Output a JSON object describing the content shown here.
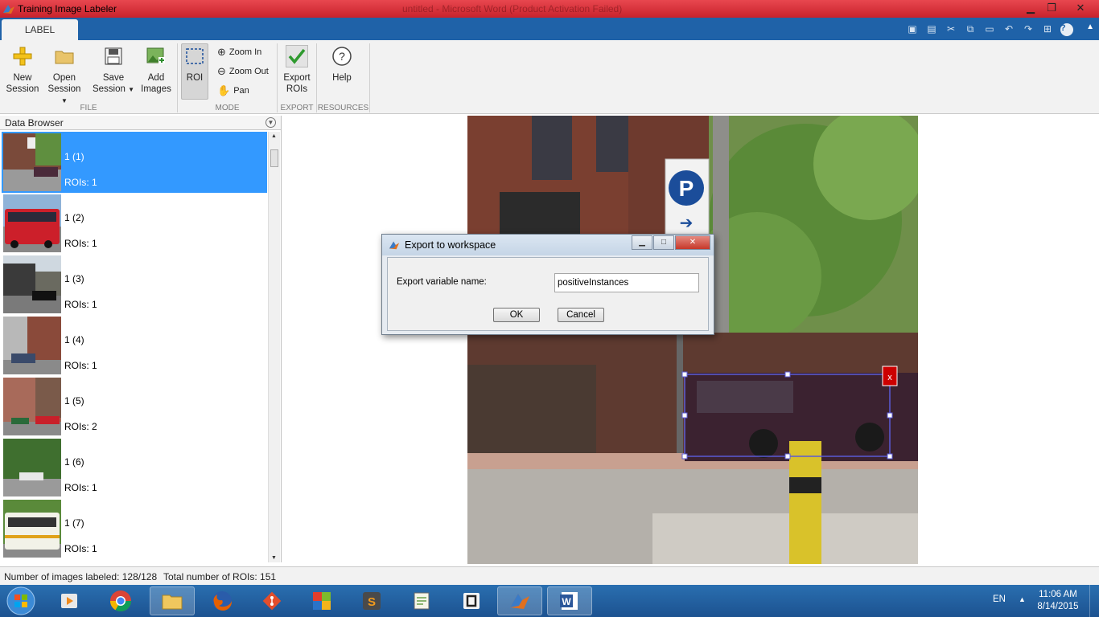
{
  "window": {
    "title": "Training Image Labeler",
    "background_title": "untitled - Microsoft Word (Product Activation Failed)"
  },
  "tabstrip": {
    "active_tab": "LABEL"
  },
  "ribbon": {
    "new_session": [
      "New",
      "Session"
    ],
    "open_session": [
      "Open",
      "Session"
    ],
    "save_session": [
      "Save",
      "Session"
    ],
    "add_images": [
      "Add",
      "Images"
    ],
    "roi": "ROI",
    "zoom_in": "Zoom In",
    "zoom_out": "Zoom Out",
    "pan": "Pan",
    "export_rois": [
      "Export",
      "ROIs"
    ],
    "help": "Help",
    "groups": {
      "file": "FILE",
      "mode": "MODE",
      "export": "EXPORT",
      "resources": "RESOURCES"
    }
  },
  "data_browser": {
    "title": "Data Browser",
    "items": [
      {
        "name": "1 (1)",
        "rois": "ROIs: 1",
        "selected": true
      },
      {
        "name": "1 (2)",
        "rois": "ROIs: 1"
      },
      {
        "name": "1 (3)",
        "rois": "ROIs: 1"
      },
      {
        "name": "1 (4)",
        "rois": "ROIs: 1"
      },
      {
        "name": "1 (5)",
        "rois": "ROIs: 2"
      },
      {
        "name": "1 (6)",
        "rois": "ROIs: 1"
      },
      {
        "name": "1 (7)",
        "rois": "ROIs: 1"
      }
    ]
  },
  "canvas": {
    "roi_delete_label": "x",
    "sign_letter": "P",
    "sign_arrow": "➔"
  },
  "status": {
    "labeled": "Number of images labeled: 128/128",
    "total_rois": "Total number of ROIs: 151"
  },
  "dialog": {
    "title": "Export to workspace",
    "label": "Export variable name:",
    "value": "positiveInstances",
    "ok": "OK",
    "cancel": "Cancel",
    "close": "✕"
  },
  "taskbar": {
    "lang": "EN",
    "time": "11:06 AM",
    "date": "8/14/2015"
  },
  "colors": {
    "title_bar": "#d9343c",
    "tab_strip": "#1f62a8",
    "selection": "#3399ff",
    "roi_box": "#5b5bd6",
    "roi_close": "#cc0000"
  }
}
